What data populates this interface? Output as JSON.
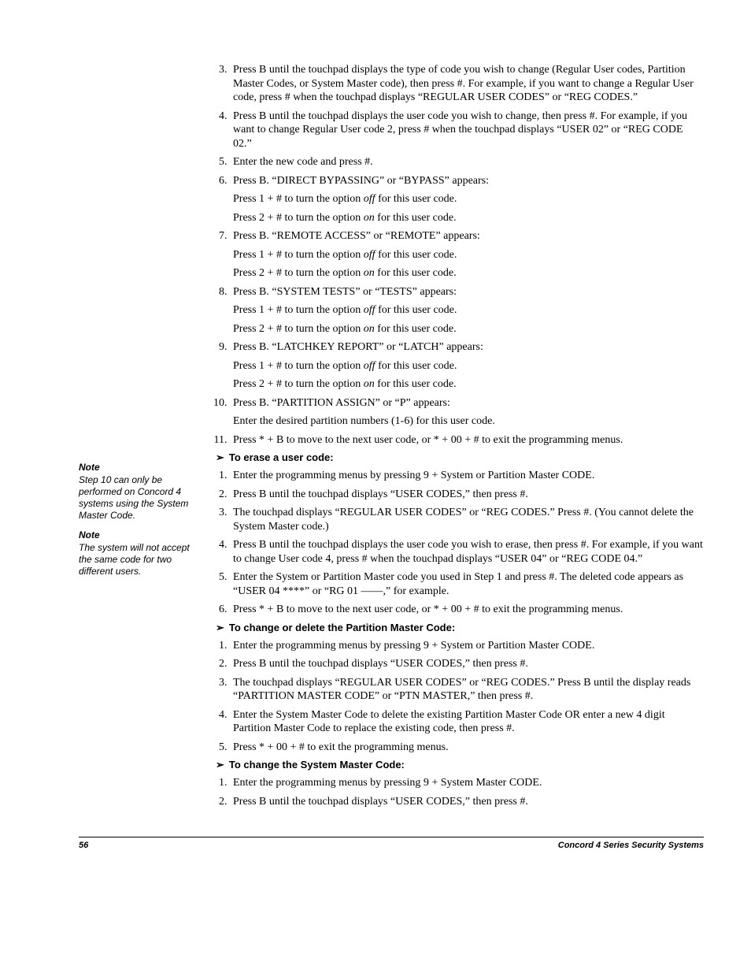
{
  "sidebar": {
    "note1_heading": "Note",
    "note1_body": "Step 10 can only be performed on Concord 4 systems using the System Master Code.",
    "note2_heading": "Note",
    "note2_body": "The system will not accept the same code for two different users."
  },
  "main": {
    "item3": "Press B until the touchpad displays the type of code you wish to change (Regular User codes, Partition Master Codes, or System Master code), then press #. For example, if you want to change a Regular User code, press # when the touchpad displays “REGULAR USER CODES” or “REG CODES.”",
    "item4": "Press B until the touchpad displays the user code you wish to change, then press #. For example, if you want to change Regular User code 2, press # when the touchpad displays “USER 02” or “REG CODE 02.”",
    "item5": "Enter the new code and press #.",
    "item6": "Press B. “DIRECT BYPASSING” or “BYPASS” appears:",
    "p_off": "Press 1 + # to turn the option ",
    "p_off_tail": " for this user code.",
    "p_on": "Press 2 + # to turn the option ",
    "p_on_tail": " for this user code.",
    "off_word": "off",
    "on_word": "on",
    "item7": "Press B. “REMOTE ACCESS” or “REMOTE” appears:",
    "item8": "Press B. “SYSTEM TESTS” or “TESTS” appears:",
    "item9": "Press B. “LATCHKEY REPORT” or “LATCH” appears:",
    "item10": "Press B. “PARTITION ASSIGN” or “P” appears:",
    "item10_sub": "Enter the desired partition numbers (1-6) for this user code.",
    "item11": "Press * + B to move to the next user code, or * + 00 + # to exit the programming menus.",
    "sec2_heading": "To erase a user code:",
    "sec2_item1": "Enter the programming menus by pressing 9 + System or Partition Master CODE.",
    "sec2_item2": "Press B until the touchpad displays “USER CODES,” then press #.",
    "sec2_item3": "The touchpad displays “REGULAR USER CODES” or “REG CODES.” Press #. (You cannot delete the System Master code.)",
    "sec2_item4": "Press B until the touchpad displays the user code you wish to erase, then press #. For example, if you want to change User code 4, press # when the touchpad displays “USER 04” or “REG CODE 04.”",
    "sec2_item5": "Enter the System or Partition Master code you used in Step 1 and press #. The deleted code appears as “USER 04 ****” or “RG 01 ——,” for example.",
    "sec2_item6": "Press * + B to move to the next user code, or * + 00 + # to exit the programming menus.",
    "sec3_heading": "To change or delete the Partition Master Code:",
    "sec3_item1": "Enter the programming menus by pressing 9 + System or Partition Master CODE.",
    "sec3_item2": "Press B until the touchpad displays “USER CODES,” then press #.",
    "sec3_item3": "The touchpad displays “REGULAR USER CODES” or “REG CODES.” Press B until the display reads “PARTITION MASTER CODE” or “PTN MASTER,” then press #.",
    "sec3_item4": "Enter the System Master Code to delete the existing Partition Master Code OR enter a new 4 digit Partition Master Code to replace the existing code, then press #.",
    "sec3_item5": "Press * + 00 + # to exit the programming menus.",
    "sec4_heading": "To change the System Master Code:",
    "sec4_item1": "Enter the programming menus by pressing 9 + System Master CODE.",
    "sec4_item2": "Press B until the touchpad displays “USER CODES,” then press #."
  },
  "footer": {
    "page": "56",
    "title": "Concord  4 Series Security Systems"
  }
}
